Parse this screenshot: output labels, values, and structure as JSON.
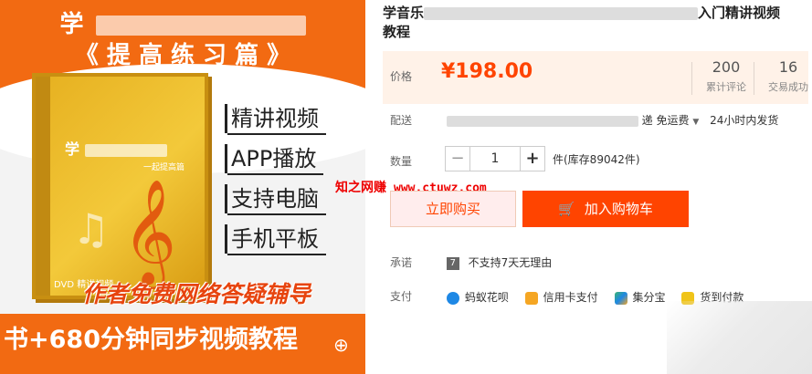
{
  "banner": {
    "top_prefix": "学",
    "subtitle": "《 提 高 练 习 篇 》",
    "dvd_title": "学",
    "dvd_sub": "一起提高篇",
    "dvd_foot": "DVD 精讲视频",
    "features": [
      "精讲视频",
      "APP播放",
      "支持电脑",
      "手机平板"
    ],
    "author_line": "作者免费网络答疑辅导",
    "bottom_line": "书+680分钟同步视频教程",
    "zoom_icon": "⊕"
  },
  "product": {
    "title_start": "学音乐",
    "title_end": "入门精讲视频",
    "title_line2": "教程"
  },
  "price": {
    "label": "价格",
    "value": "¥198.00",
    "reviews_count": "200",
    "reviews_label": "累计评论",
    "deals_count": "16",
    "deals_label": "交易成功"
  },
  "shipping": {
    "label": "配送",
    "method": "递 免运费",
    "time": "24小时内发货"
  },
  "quantity": {
    "label": "数量",
    "minus": "−",
    "value": "1",
    "plus": "+",
    "stock": "件(库存89042件)"
  },
  "watermark": {
    "text": "知之网赚",
    "url": "www.ctuwz.com"
  },
  "actions": {
    "buy_now": "立即购买",
    "add_to_cart": "加入购物车"
  },
  "promise": {
    "label": "承诺",
    "icon_text": "7",
    "text": "不支持7天无理由"
  },
  "payment": {
    "label": "支付",
    "methods": [
      {
        "label": "蚂蚁花呗",
        "color": "#1e88e5"
      },
      {
        "label": "信用卡支付",
        "color": "#f5a623"
      },
      {
        "label": "集分宝",
        "color": "#3cb371"
      },
      {
        "label": "货到付款",
        "color": "#f0c419"
      }
    ]
  },
  "colors": {
    "accent": "#ff4400",
    "banner_orange": "#f26a12",
    "price_bg": "#fff2e8"
  }
}
